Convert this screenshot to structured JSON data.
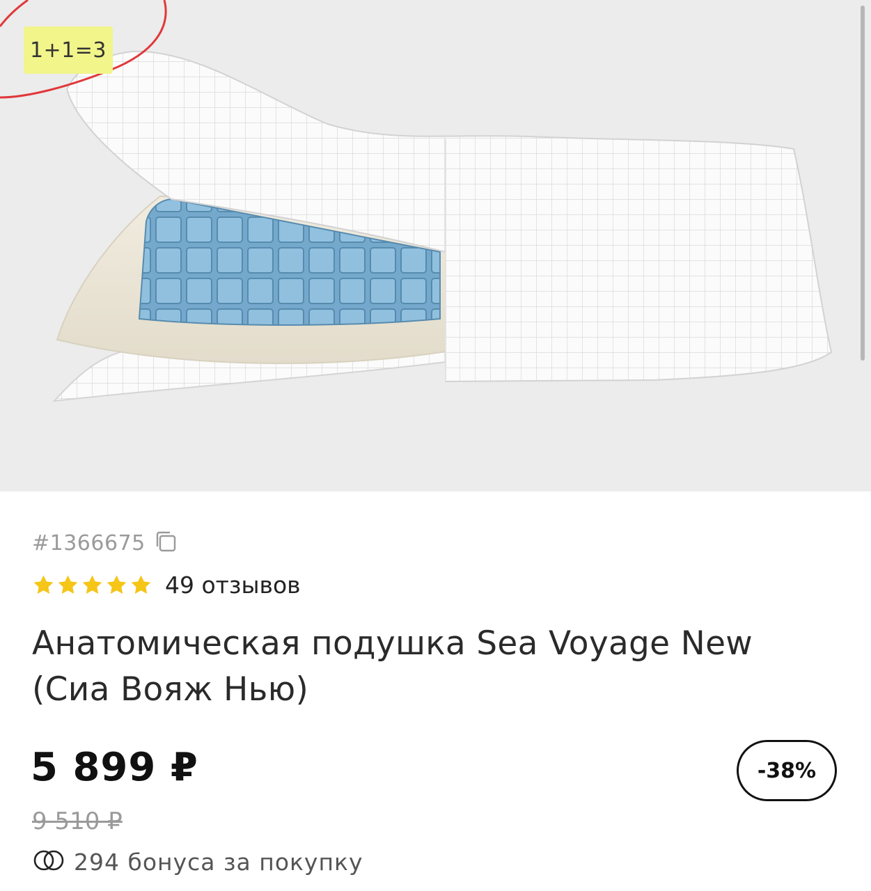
{
  "product": {
    "promo_label": "1+1=3",
    "sku": "#1366675",
    "rating_stars": 5,
    "reviews_label": "49 отзывов",
    "title": "Анатомическая подушка Sea Voyage New (Сиа Вояж Нью)",
    "price": "5 899 ₽",
    "old_price": "9 510 ₽",
    "discount": "-38%",
    "bonus": "294 бонуса за покупку"
  },
  "icons": {
    "copy": "copy-icon",
    "star": "star-icon",
    "bonus": "coins-icon"
  },
  "colors": {
    "promo_bg": "#f1f58a",
    "star": "#f5c518",
    "annotation_circle": "#e0383b"
  }
}
